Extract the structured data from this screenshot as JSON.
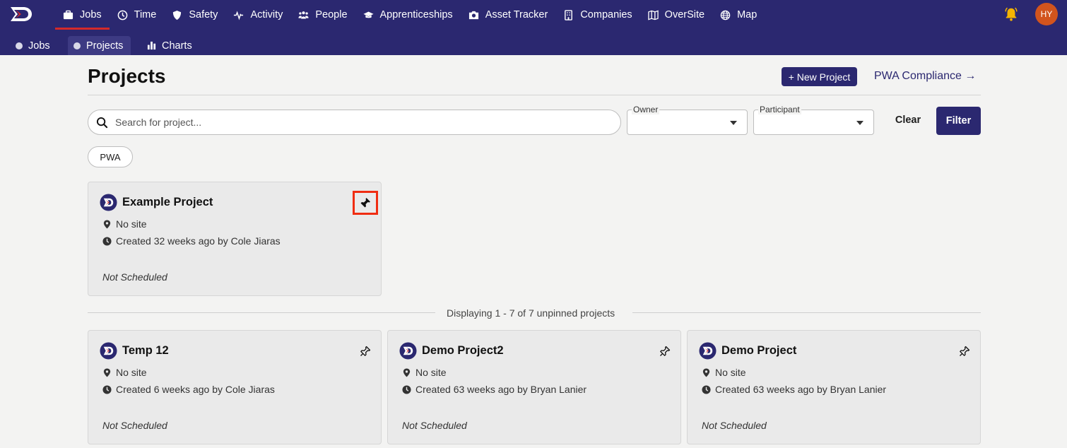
{
  "nav": {
    "items": [
      {
        "label": "Jobs",
        "icon": "briefcase-icon",
        "active": true
      },
      {
        "label": "Time",
        "icon": "clock-icon"
      },
      {
        "label": "Safety",
        "icon": "shield-icon"
      },
      {
        "label": "Activity",
        "icon": "pulse-icon"
      },
      {
        "label": "People",
        "icon": "people-icon"
      },
      {
        "label": "Apprenticeships",
        "icon": "graduation-cap-icon"
      },
      {
        "label": "Asset Tracker",
        "icon": "camera-icon"
      },
      {
        "label": "Companies",
        "icon": "building-icon"
      },
      {
        "label": "OverSite",
        "icon": "map-icon"
      },
      {
        "label": "Map",
        "icon": "globe-icon"
      }
    ],
    "avatar_initials": "HY",
    "colors": {
      "primary": "#2b2870",
      "active_underline": "#d42a2a",
      "bell": "#f5b400",
      "avatar": "#d2541d"
    }
  },
  "subnav": {
    "items": [
      {
        "label": "Jobs"
      },
      {
        "label": "Projects",
        "active": true
      },
      {
        "label": "Charts"
      }
    ]
  },
  "header": {
    "title": "Projects",
    "new_project_label": "+ New Project",
    "pwa_link_label": "PWA Compliance →"
  },
  "filters": {
    "search_placeholder": "Search for project...",
    "owner_label": "Owner",
    "participant_label": "Participant",
    "clear_label": "Clear",
    "filter_label": "Filter",
    "chip_label": "PWA"
  },
  "pinned_projects": [
    {
      "title": "Example Project",
      "site": "No site",
      "created": "Created 32 weeks ago by Cole Jiaras",
      "schedule": "Not Scheduled"
    }
  ],
  "display_text": "Displaying 1 - 7 of 7 unpinned projects",
  "projects": [
    {
      "title": "Temp 12",
      "site": "No site",
      "created": "Created 6 weeks ago by Cole Jiaras",
      "schedule": "Not Scheduled"
    },
    {
      "title": "Demo Project2",
      "site": "No site",
      "created": "Created 63 weeks ago by Bryan Lanier",
      "schedule": "Not Scheduled"
    },
    {
      "title": "Demo Project",
      "site": "No site",
      "created": "Created 63 weeks ago by Bryan Lanier",
      "schedule": "Not Scheduled"
    }
  ]
}
